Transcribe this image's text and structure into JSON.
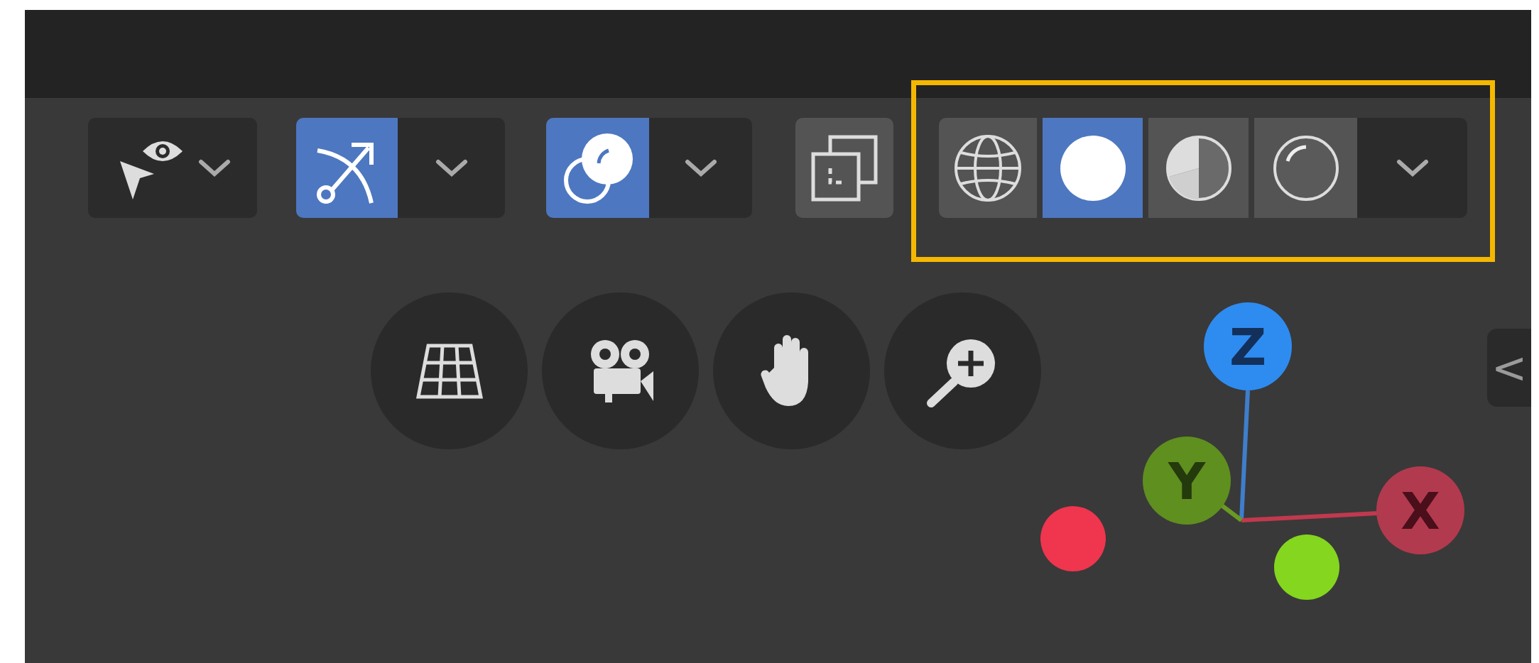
{
  "toolbar": {
    "visibility": {
      "kind": "eye"
    },
    "gizmo_toggle": {
      "selected": true
    },
    "overlay_toggle": {
      "selected": true
    },
    "xray_toggle": {
      "selected": false
    },
    "shading_modes": [
      {
        "kind": "wireframe",
        "selected": false
      },
      {
        "kind": "solid",
        "selected": true
      },
      {
        "kind": "material",
        "selected": false
      },
      {
        "kind": "rendered",
        "selected": false
      }
    ],
    "shading_highlighted": true
  },
  "navigation": [
    {
      "kind": "grid"
    },
    {
      "kind": "camera"
    },
    {
      "kind": "hand"
    },
    {
      "kind": "zoom"
    }
  ],
  "axis_gizmo": {
    "z_label": "Z",
    "y_label": "Y",
    "x_label": "X"
  },
  "sidebar_tab": {
    "label": "<"
  }
}
